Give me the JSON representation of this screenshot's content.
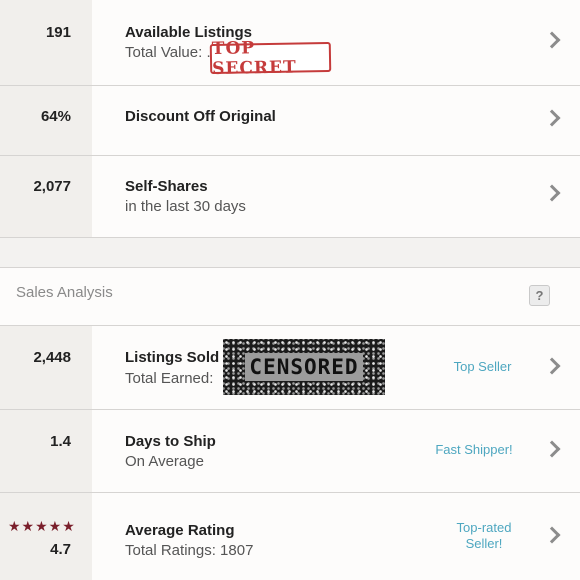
{
  "rows": [
    {
      "stat": "191",
      "title": "Available Listings",
      "sub": "Total Value: ."
    },
    {
      "stat": "64%",
      "title": "Discount Off Original"
    },
    {
      "stat": "2,077",
      "title": "Self-Shares",
      "sub": "in the last 30 days"
    }
  ],
  "redactions": {
    "top_secret": "TOP SECRET",
    "censored": "CENSORED"
  },
  "section": {
    "title": "Sales Analysis",
    "help_icon": "?"
  },
  "sales": [
    {
      "stat": "2,448",
      "title": "Listings Sold",
      "sub": "Total Earned:",
      "badge": "Top Seller"
    },
    {
      "stat": "1.4",
      "title": "Days to Ship",
      "sub": "On Average",
      "badge": "Fast Shipper!"
    },
    {
      "stat": "4.7",
      "title": "Average Rating",
      "sub": "Total Ratings: 1807",
      "badge_line1": "Top-rated",
      "badge_line2": "Seller!",
      "stars": "★★★★★",
      "rating": 5
    }
  ],
  "colors": {
    "accent": "#4ea7c0",
    "star": "#7a1f2b",
    "stamp": "#c53b3b"
  }
}
